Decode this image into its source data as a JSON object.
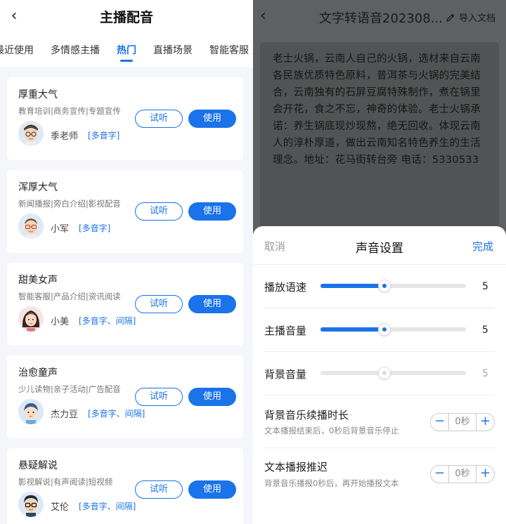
{
  "left": {
    "back_glyph": "‹",
    "title": "主播配音",
    "tabs": [
      {
        "label": "最近使用"
      },
      {
        "label": "多情感主播"
      },
      {
        "label": "热门"
      },
      {
        "label": "直播场景"
      },
      {
        "label": "智能客服"
      }
    ],
    "active_tab": "热门",
    "listen_label": "试听",
    "use_label": "使用",
    "voices": [
      {
        "name": "厚重大气",
        "desc": "教育培训|商务宣传|专题宣传",
        "person": "季老师",
        "tag": "[多音字]",
        "avatar_icon": "avatar-man-glasses-icon"
      },
      {
        "name": "浑厚大气",
        "desc": "新闻播报|旁白介绍|影视配音",
        "person": "小军",
        "tag": "[多音字]",
        "avatar_icon": "avatar-man-glasses-icon"
      },
      {
        "name": "甜美女声",
        "desc": "智能客服|产品介绍|资讯阅读",
        "person": "小美",
        "tag": "[多音字、间隔]",
        "avatar_icon": "avatar-woman-icon"
      },
      {
        "name": "治愈童声",
        "desc": "少儿读物|亲子活动|广告配音",
        "person": "杰力豆",
        "tag": "[多音字、间隔]",
        "avatar_icon": "avatar-boy-icon"
      },
      {
        "name": "悬疑解说",
        "desc": "影视解说|有声阅读|短视频",
        "person": "艾伦",
        "tag": "[多音字、间隔]",
        "avatar_icon": "avatar-man-dark-glasses-icon"
      }
    ],
    "accent_color": "#1a73e8"
  },
  "right": {
    "back_glyph": "‹",
    "doc_title": "文字转语音202308...",
    "import_label": "导入文档",
    "import_icon": "pen-icon",
    "content_text": "老士火锅，云南人自己的火锅，选材来自云南各民族优质特色原料，普洱茶与火锅的完美结合，云南独有的石屏豆腐特殊制作，煮在锅里会开花，食之不忘，神奇的体验。老士火锅承诺：养生锅底现炒现熬，绝无回收。体现云南人的淳朴厚道，做出云南知名特色养生的生活理念。地址：花马街转台旁 电话：5330533",
    "sheet": {
      "cancel_label": "取消",
      "title": "声音设置",
      "done_label": "完成",
      "sliders": [
        {
          "label": "播放语速",
          "value": "5",
          "fraction": 0.44,
          "enabled": true
        },
        {
          "label": "主播音量",
          "value": "5",
          "fraction": 0.44,
          "enabled": true
        },
        {
          "label": "背景音量",
          "value": "5",
          "fraction": 0.44,
          "enabled": false
        }
      ],
      "steppers": [
        {
          "label": "背景音乐续播时长",
          "hint": "文本播报结束后，0秒后背景音乐停止",
          "value": "0秒",
          "minus": "−",
          "plus": "+"
        },
        {
          "label": "文本播报推迟",
          "hint": "背景音乐播报0秒后，再开始播报文本",
          "value": "0秒",
          "minus": "−",
          "plus": "+"
        }
      ]
    }
  }
}
